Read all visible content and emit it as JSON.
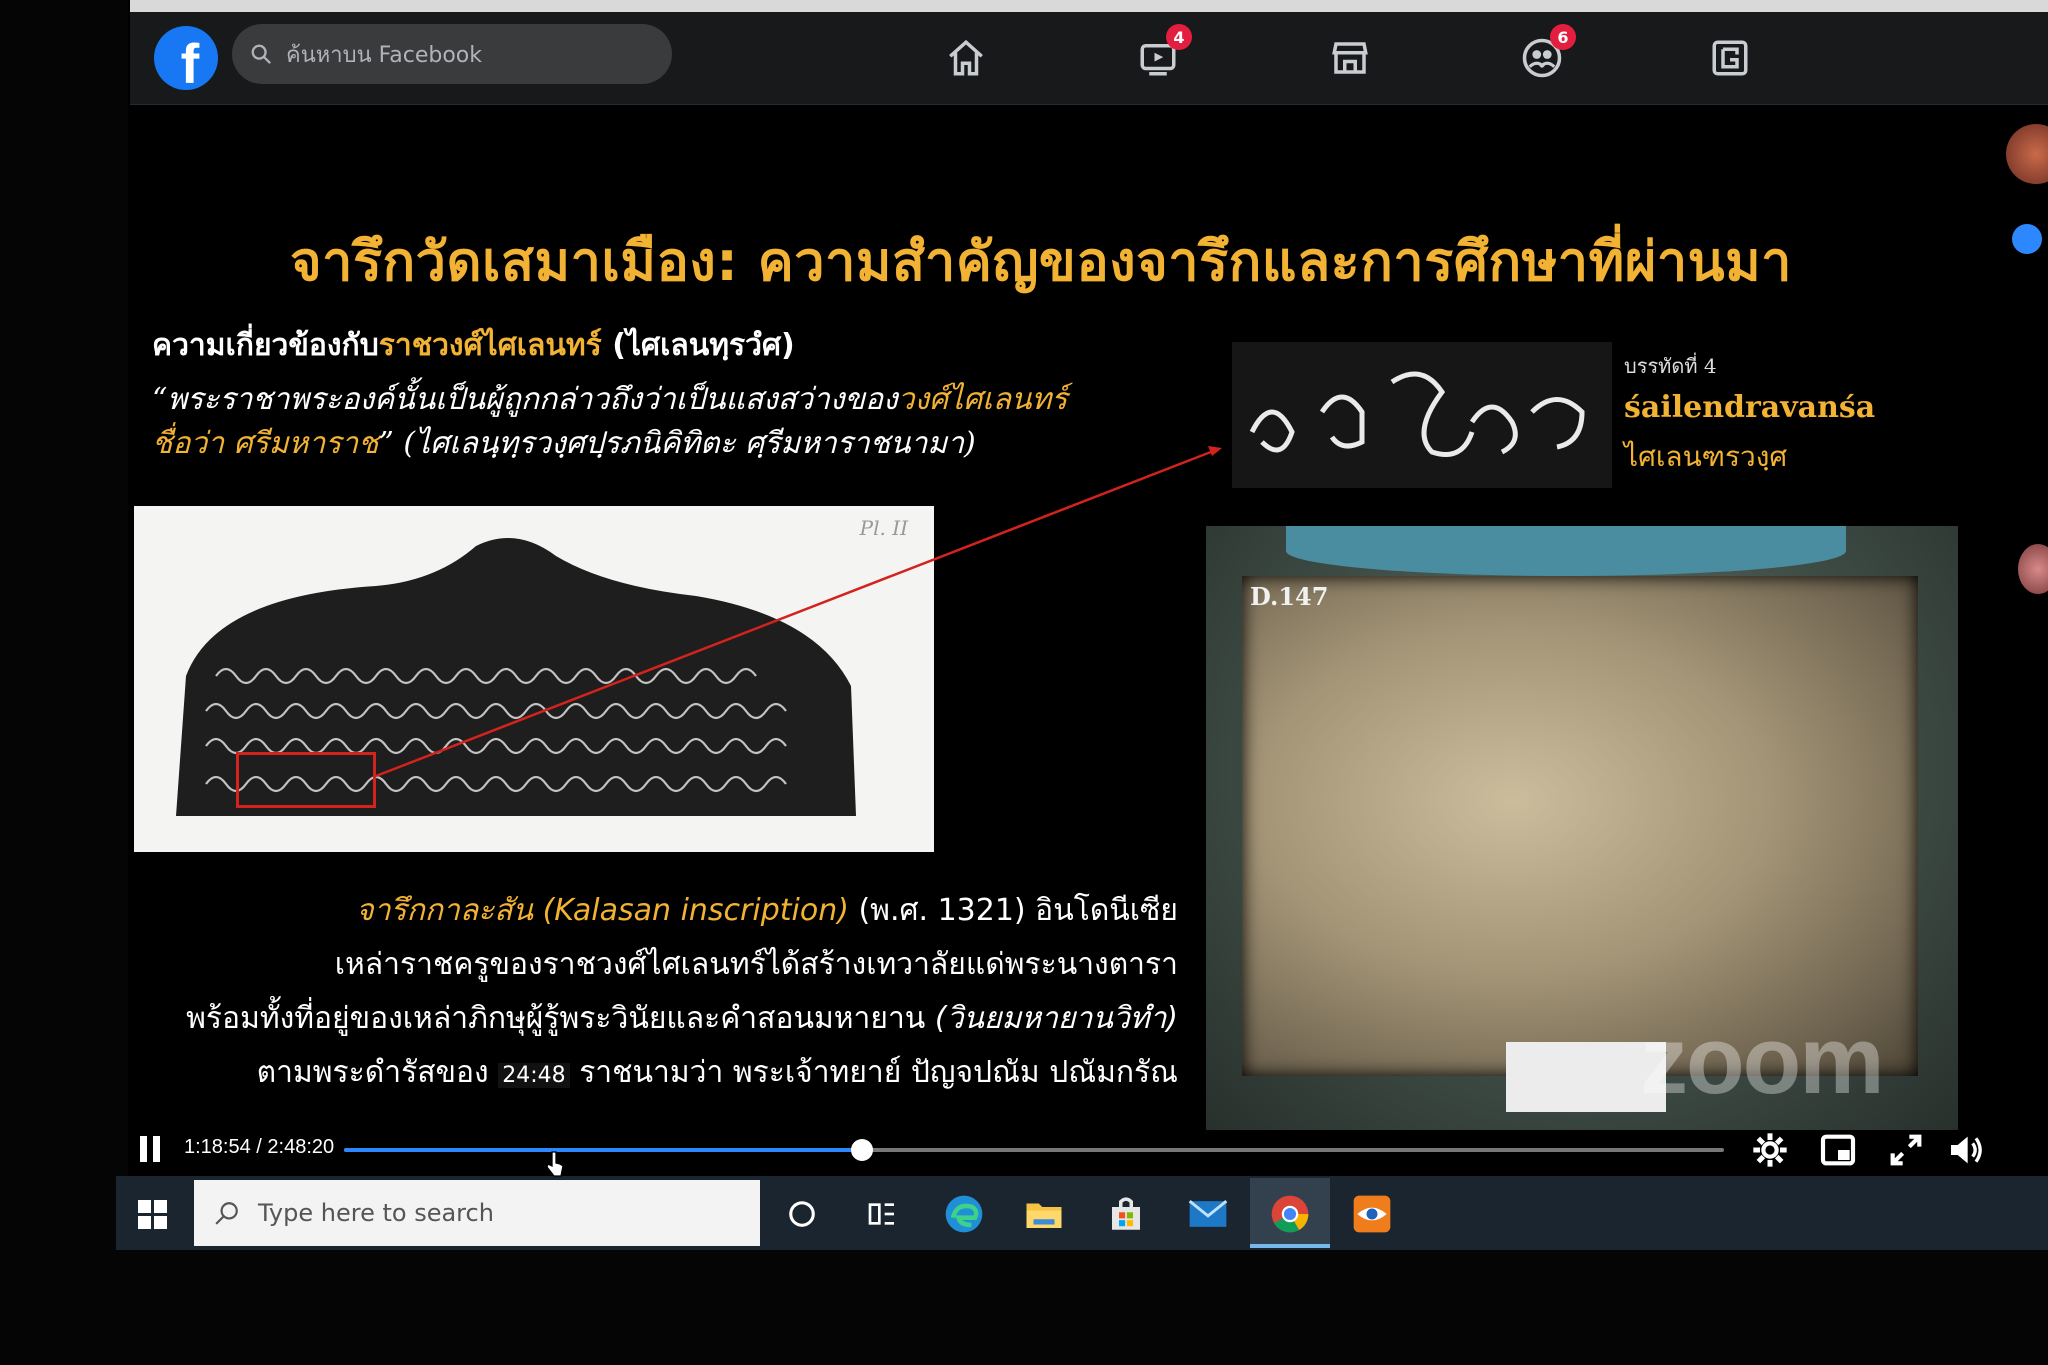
{
  "facebook": {
    "search_placeholder": "ค้นหาบน Facebook",
    "badges": {
      "watch": "4",
      "groups": "6"
    }
  },
  "slide": {
    "title": "จารึกวัดเสมาเมือง: ความสำคัญของจารึกและการศึกษาที่ผ่านมา",
    "subhead_prefix": "ความเกี่ยวข้องกับ",
    "subhead_highlight": "ราชวงศ์ไศเลนทร์",
    "subhead_suffix": " (ไศเลนทฺรวํศ)",
    "quote_line1_a": "“พระราชาพระองค์นั้นเป็นผู้ถูกกล่าวถึงว่าเป็นแสงสว่างของ",
    "quote_line1_hl": "วงศ์ไศเลนทร์",
    "quote_line2_hl": "ชื่อว่า ศรีมหาราช",
    "quote_line2_b": "” (ไศเลนฺทฺรวงฺศปฺรภนิคิทิตะ ศฺรีมหาราชนามา)",
    "plate_label": "Pl. II",
    "detail_line_no": "บรรทัดที่ 4",
    "detail_roman": "śailendravanśa",
    "detail_thai": "ไศเลนฑรวงฺศ",
    "photo_label": "D.147",
    "body": {
      "line1_hl": "จารึกกาละสัน (Kalasan inscription)",
      "line1_rest": " (พ.ศ. 1321) อินโดนีเซีย",
      "line2": "เหล่าราชครูของราชวงศ์ไศเลนทร์ได้สร้างเทวาลัยแด่พระนางตารา",
      "line3_a": "พร้อมทั้งที่อยู่ของเหล่าภิกษุผู้รู้พระวินัยและคำสอนมหายาน ",
      "line3_it": "(วินยมหายานวิทำ)",
      "line4_a": "ตามพระดำรัสของ ",
      "line4_tip": "24:48",
      "line4_b": " ราชนามว่า พระเจ้าทยาย์ ปัญจปณัม ปณัมกรัณ"
    },
    "watermark": "zoom"
  },
  "video": {
    "time": "1:18:54 / 2:48:20",
    "progress": 0.375
  },
  "taskbar": {
    "search_placeholder": "Type here to search"
  },
  "colors": {
    "accent_gold": "#f2b233",
    "facebook_blue": "#1877f2",
    "progress_blue": "#2d88ff",
    "taskbar": "#1b2530"
  }
}
